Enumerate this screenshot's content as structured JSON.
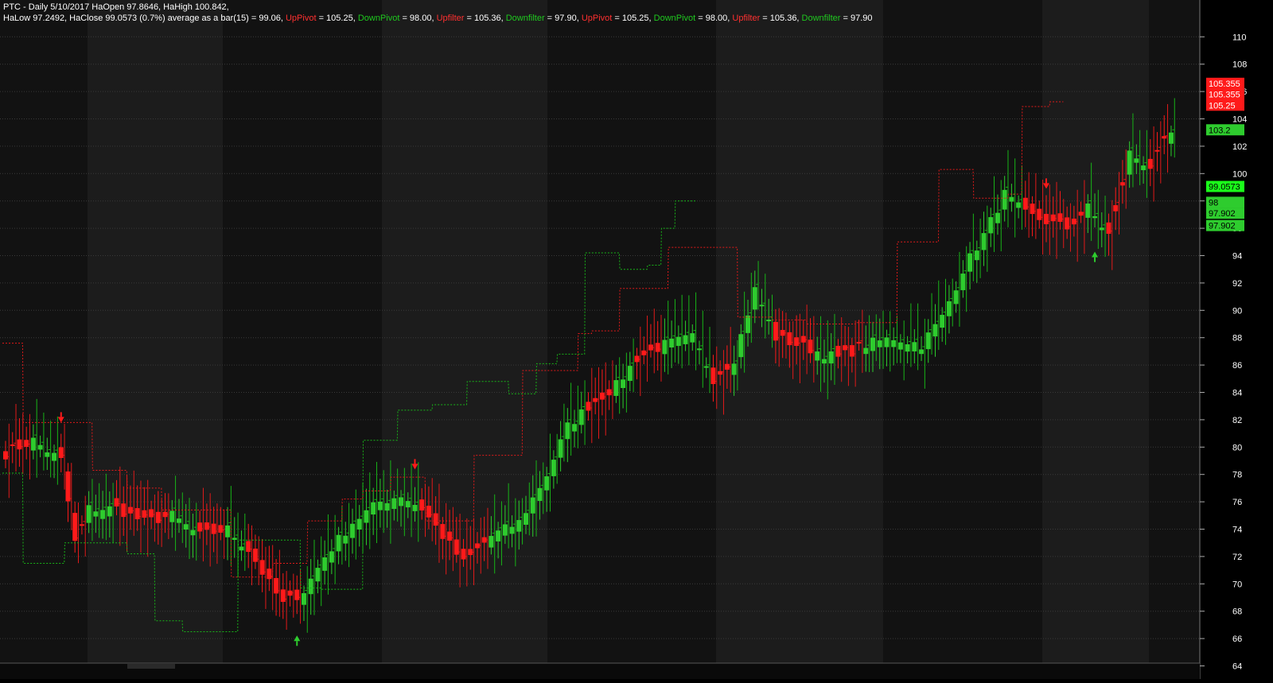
{
  "header": {
    "line1": "PTC - Daily 5/10/2017 HaOpen 97.8646, HaHigh 100.842,",
    "line2_parts": [
      {
        "text": "HaLow 97.2492, HaClose 99.0573 (0.7%) average as a bar(15) = 99.06, ",
        "color": "white"
      },
      {
        "text": "UpPivot",
        "color": "red"
      },
      {
        "text": " = 105.25, ",
        "color": "white"
      },
      {
        "text": "DownPivot",
        "color": "green"
      },
      {
        "text": " = 98.00, ",
        "color": "white"
      },
      {
        "text": "Upfilter",
        "color": "red"
      },
      {
        "text": " = 105.36, ",
        "color": "white"
      },
      {
        "text": "Downfilter",
        "color": "green"
      },
      {
        "text": " = 97.90, ",
        "color": "white"
      },
      {
        "text": "UpPivot",
        "color": "red"
      },
      {
        "text": " = 105.25, ",
        "color": "white"
      },
      {
        "text": "DownPivot",
        "color": "green"
      },
      {
        "text": " = 98.00, ",
        "color": "white"
      },
      {
        "text": "Upfilter",
        "color": "red"
      },
      {
        "text": " = 105.36, ",
        "color": "white"
      },
      {
        "text": "Downfilter",
        "color": "green"
      },
      {
        "text": " = 97.90",
        "color": "white"
      }
    ]
  },
  "colors": {
    "background": "#000000",
    "band_dark": "#121212",
    "band_light": "#1c1c1c",
    "grid": "#3a3a3a",
    "up": "#2ecc2e",
    "down": "#ff1a1a",
    "up_line": "#18b418",
    "down_line": "#e01a1a",
    "axis_text": "#ffffff",
    "axis_bg": "#000000"
  },
  "chart_data": {
    "type": "candlestick",
    "ylim": [
      63,
      111
    ],
    "y_ticks": [
      64,
      66,
      68,
      70,
      72,
      74,
      76,
      78,
      80,
      82,
      84,
      86,
      88,
      90,
      92,
      94,
      96,
      98,
      100,
      102,
      104,
      106,
      108,
      110
    ],
    "price_labels": [
      {
        "text": "105.355",
        "value": 106.6,
        "color": "#ff1a1a",
        "text_color": "#ffffff"
      },
      {
        "text": "105.355",
        "value": 105.8,
        "color": "#ff1a1a",
        "text_color": "#ffffff"
      },
      {
        "text": "105.25",
        "value": 105.0,
        "color": "#ff1a1a",
        "text_color": "#ffffff"
      },
      {
        "text": "103.2",
        "value": 103.2,
        "color": "#2ecc2e",
        "text_color": "#000000"
      },
      {
        "text": "99.0573",
        "value": 99.0573,
        "color": "#1aff1a",
        "text_color": "#000000"
      },
      {
        "text": "98",
        "value": 97.9,
        "color": "#2ecc2e",
        "text_color": "#000000"
      },
      {
        "text": "97.902",
        "value": 97.1,
        "color": "#2ecc2e",
        "text_color": "#000000"
      },
      {
        "text": "97.902",
        "value": 96.2,
        "color": "#2ecc2e",
        "text_color": "#000000"
      }
    ],
    "anchors": [
      [
        0,
        79.5,
        0
      ],
      [
        4,
        80.5,
        1
      ],
      [
        8,
        79.0,
        0
      ],
      [
        10,
        73.0,
        0
      ],
      [
        12,
        75.5,
        1
      ],
      [
        16,
        75.5,
        0
      ],
      [
        20,
        74.5,
        0
      ],
      [
        24,
        75.0,
        1
      ],
      [
        28,
        73.5,
        0
      ],
      [
        32,
        74.0,
        1
      ],
      [
        35,
        72.5,
        0
      ],
      [
        38,
        70.0,
        0
      ],
      [
        40,
        68.5,
        0
      ],
      [
        43,
        69.5,
        1
      ],
      [
        46,
        72.0,
        1
      ],
      [
        50,
        74.5,
        1
      ],
      [
        54,
        76.0,
        1
      ],
      [
        57,
        76.5,
        1
      ],
      [
        60,
        75.5,
        0
      ],
      [
        63,
        73.5,
        0
      ],
      [
        66,
        71.5,
        0
      ],
      [
        70,
        73.5,
        1
      ],
      [
        74,
        74.5,
        1
      ],
      [
        78,
        78.0,
        1
      ],
      [
        81,
        81.5,
        1
      ],
      [
        84,
        83.0,
        0
      ],
      [
        88,
        84.5,
        1
      ],
      [
        91,
        86.5,
        0
      ],
      [
        95,
        87.5,
        1
      ],
      [
        99,
        88.0,
        1
      ],
      [
        102,
        85.0,
        0
      ],
      [
        105,
        86.5,
        1
      ],
      [
        108,
        91.5,
        1
      ],
      [
        111,
        88.0,
        0
      ],
      [
        114,
        87.5,
        0
      ],
      [
        117,
        87.0,
        1
      ],
      [
        120,
        86.5,
        0
      ],
      [
        124,
        87.5,
        1
      ],
      [
        128,
        88.0,
        1
      ],
      [
        132,
        87.5,
        1
      ],
      [
        135,
        89.5,
        1
      ],
      [
        138,
        93.0,
        1
      ],
      [
        141,
        95.5,
        1
      ],
      [
        144,
        98.5,
        1
      ],
      [
        147,
        97.0,
        0
      ],
      [
        150,
        96.5,
        0
      ],
      [
        153,
        96.0,
        0
      ],
      [
        156,
        97.5,
        1
      ],
      [
        159,
        95.5,
        0
      ],
      [
        162,
        101.5,
        1
      ],
      [
        165,
        100.5,
        0
      ],
      [
        168,
        103.0,
        1
      ]
    ],
    "ha_bar_count": 169,
    "up_pivot_steps": [
      [
        0,
        2,
        87.6
      ],
      [
        3,
        12,
        81.8
      ],
      [
        13,
        17,
        78.3
      ],
      [
        18,
        22,
        77.0
      ],
      [
        23,
        32,
        75.4
      ],
      [
        33,
        38,
        70.5
      ],
      [
        39,
        43,
        71.5
      ],
      [
        44,
        48,
        74.6
      ],
      [
        49,
        51,
        76.2
      ],
      [
        52,
        55,
        76.8
      ],
      [
        56,
        60,
        77.8
      ],
      [
        61,
        67,
        74.6
      ],
      [
        68,
        74,
        79.4
      ],
      [
        75,
        82,
        85.6
      ],
      [
        83,
        84,
        88.3
      ],
      [
        85,
        88,
        88.5
      ],
      [
        89,
        95,
        91.6
      ],
      [
        96,
        105,
        94.6
      ],
      [
        106,
        110,
        89.5
      ],
      [
        111,
        115,
        89.3
      ],
      [
        116,
        122,
        89.0
      ],
      [
        123,
        128,
        89.1
      ],
      [
        129,
        134,
        95.0
      ],
      [
        135,
        139,
        100.3
      ],
      [
        140,
        144,
        98.2
      ],
      [
        145,
        146,
        98.5
      ],
      [
        147,
        150,
        104.9
      ],
      [
        151,
        152,
        105.25
      ]
    ],
    "down_pivot_steps": [
      [
        0,
        2,
        78.1
      ],
      [
        3,
        8,
        71.5
      ],
      [
        9,
        17,
        73.0
      ],
      [
        18,
        21,
        72.2
      ],
      [
        22,
        25,
        67.3
      ],
      [
        26,
        33,
        66.5
      ],
      [
        34,
        42,
        73.2
      ],
      [
        43,
        45,
        69.7
      ],
      [
        46,
        51,
        69.6
      ],
      [
        52,
        56,
        80.5
      ],
      [
        57,
        61,
        82.7
      ],
      [
        62,
        66,
        83.1
      ],
      [
        67,
        72,
        84.8
      ],
      [
        73,
        76,
        83.9
      ],
      [
        77,
        79,
        86.1
      ],
      [
        80,
        83,
        86.8
      ],
      [
        84,
        88,
        94.2
      ],
      [
        89,
        92,
        93.0
      ],
      [
        93,
        94,
        93.3
      ],
      [
        95,
        96,
        96.0
      ],
      [
        97,
        99,
        98.0
      ]
    ],
    "arrows": [
      {
        "bar": 8,
        "dir": "down"
      },
      {
        "bar": 42,
        "dir": "up"
      },
      {
        "bar": 59,
        "dir": "down"
      },
      {
        "bar": 150,
        "dir": "down"
      },
      {
        "bar": 157,
        "dir": "up"
      }
    ]
  }
}
